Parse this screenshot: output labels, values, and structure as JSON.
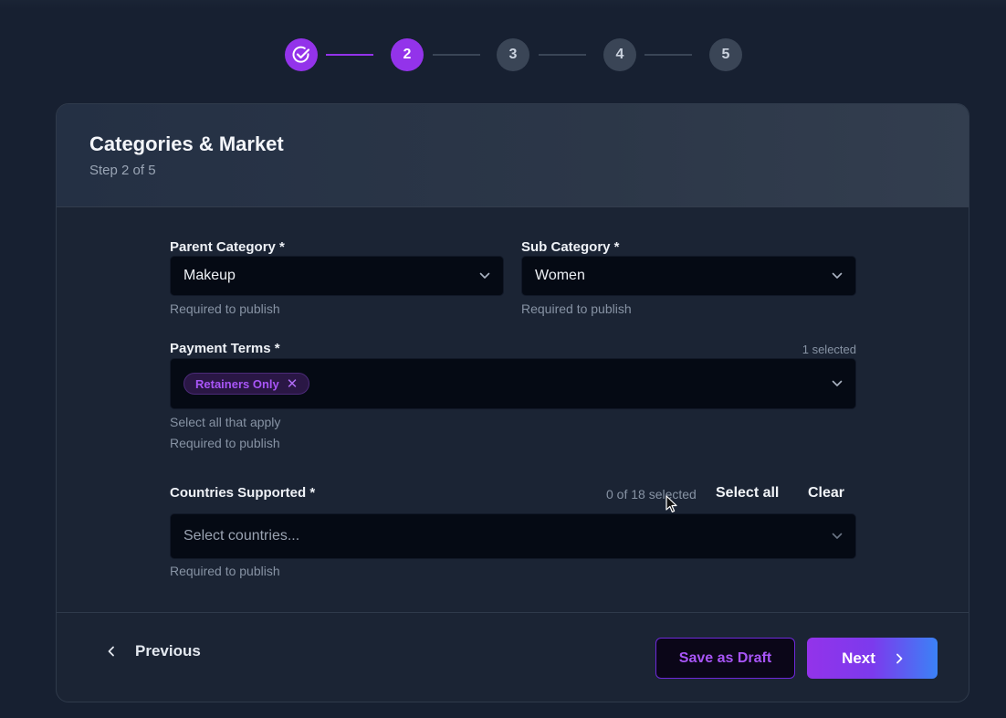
{
  "stepper": {
    "steps": [
      {
        "label": "",
        "state": "done",
        "icon": "check-circle-icon"
      },
      {
        "label": "2",
        "state": "active"
      },
      {
        "label": "3",
        "state": "pending"
      },
      {
        "label": "4",
        "state": "pending"
      },
      {
        "label": "5",
        "state": "pending"
      }
    ]
  },
  "card": {
    "title": "Categories & Market",
    "subtitle": "Step 2 of 5"
  },
  "form": {
    "parent_category": {
      "label": "Parent Category *",
      "value": "Makeup",
      "helper": "Required to publish"
    },
    "sub_category": {
      "label": "Sub Category *",
      "value": "Women",
      "helper": "Required to publish"
    },
    "payment_terms": {
      "label": "Payment Terms *",
      "count": "1 selected",
      "chips": [
        "Retainers Only"
      ],
      "chip_remove_glyph": "✕",
      "helper_1": "Select all that apply",
      "helper_2": "Required to publish"
    },
    "countries": {
      "label": "Countries Supported *",
      "count": "0 of 18 selected",
      "select_all": "Select all",
      "clear": "Clear",
      "placeholder": "Select countries...",
      "helper": "Required to publish"
    }
  },
  "footer": {
    "previous": "Previous",
    "save_draft": "Save as Draft",
    "next": "Next"
  },
  "colors": {
    "accent": "#9333ea",
    "gradient_end": "#3b82f6",
    "background": "#172031"
  }
}
